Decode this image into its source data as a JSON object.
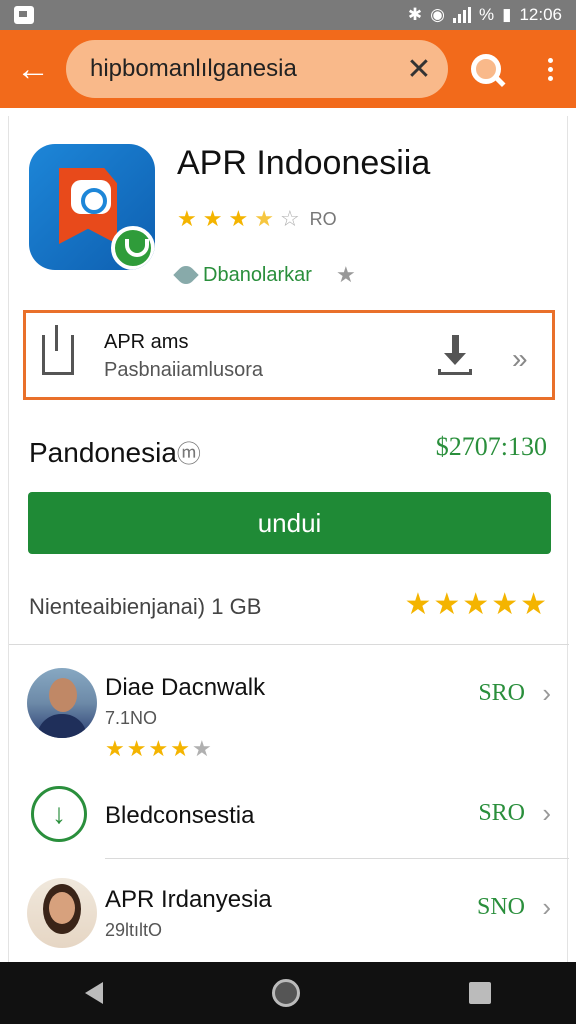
{
  "status_bar": {
    "time": "12:06",
    "battery": "%"
  },
  "search": {
    "query": "hipbomanlılganesia"
  },
  "app": {
    "title": "APR Indoonesiia",
    "rating_stars": 3.5,
    "rating_count": "RO",
    "developer": "Dbanolarkar"
  },
  "info_box": {
    "title": "APR ams",
    "subtitle": "Pasbnaiiamlusora"
  },
  "price_row": {
    "label": "Pandonesia",
    "label_suffix": "ⓜ",
    "value": "$2707:130"
  },
  "install_button": {
    "label": "undui"
  },
  "meta": {
    "text": "Nienteaibienjanai) 1 GB",
    "stars": 5
  },
  "list": [
    {
      "title": "Diae Dacnwalk",
      "subtitle": "7.1NO",
      "stars": 4,
      "price": "SRO",
      "kind": "avatar-man"
    },
    {
      "title": "Bledconsestia",
      "subtitle": "",
      "stars": 0,
      "price": "SRO",
      "kind": "download"
    },
    {
      "title": "APR Irdanyesia",
      "subtitle": "29ltıltO",
      "stars": 0,
      "price": "SNO",
      "kind": "avatar-woman"
    }
  ],
  "colors": {
    "appbar": "#f26a1b",
    "accent_green": "#1f8a36",
    "highlight_border": "#e9702a",
    "star": "#f4b400"
  },
  "icons": [
    "back-arrow-icon",
    "clear-icon",
    "search-icon",
    "more-vert-icon",
    "share-icon",
    "download-icon",
    "forward-icon",
    "chevron-right-icon"
  ]
}
